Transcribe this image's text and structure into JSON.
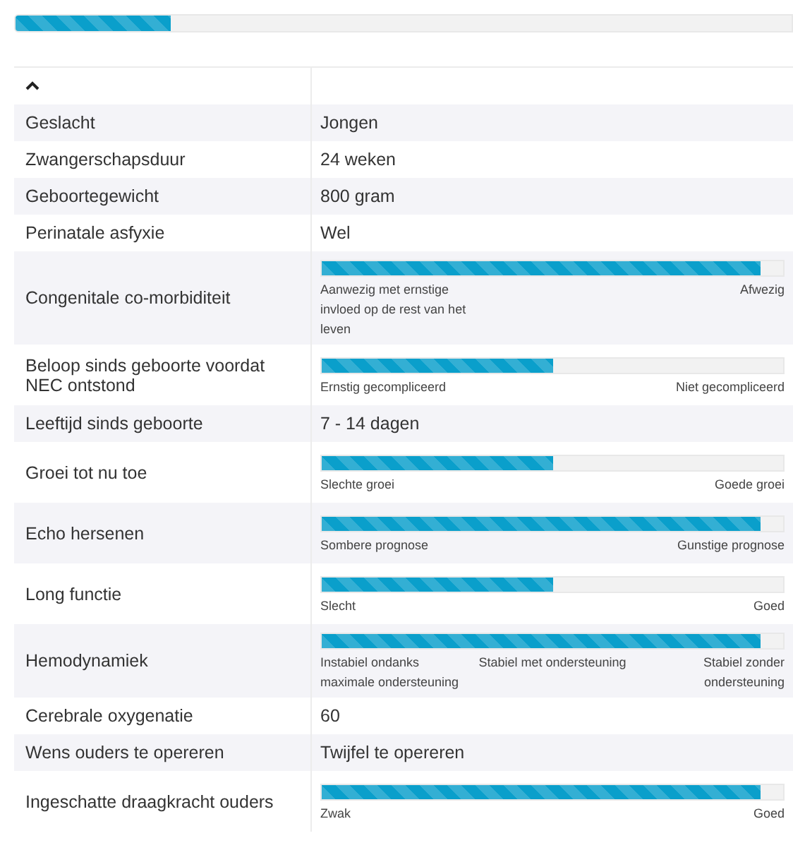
{
  "progress": {
    "level": 0.2
  },
  "table": {
    "collapsed": false,
    "rows": [
      {
        "label": "Geslacht",
        "kind": "text",
        "value": "Jongen"
      },
      {
        "label": "Zwangerschapsduur",
        "kind": "text",
        "value": "24 weken"
      },
      {
        "label": "Geboortegewicht",
        "kind": "text",
        "value": "800 gram"
      },
      {
        "label": "Perinatale asfyxie",
        "kind": "text",
        "value": "Wel"
      },
      {
        "label": "Congenitale co-morbiditeit",
        "kind": "scale",
        "level": 0.95,
        "scale_labels": [
          "Aanwezig met ernstige invloed op de rest van het leven",
          "Afwezig"
        ]
      },
      {
        "label": "Beloop sinds geboorte voordat NEC ontstond",
        "kind": "scale",
        "level": 0.5,
        "scale_labels": [
          "Ernstig gecompliceerd",
          "Niet gecompliceerd"
        ]
      },
      {
        "label": "Leeftijd sinds geboorte",
        "kind": "text",
        "value": "7 - 14 dagen"
      },
      {
        "label": "Groei tot nu toe",
        "kind": "scale",
        "level": 0.5,
        "scale_labels": [
          "Slechte groei",
          "Goede groei"
        ]
      },
      {
        "label": "Echo hersenen",
        "kind": "scale",
        "level": 0.95,
        "scale_labels": [
          "Sombere prognose",
          "Gunstige prognose"
        ]
      },
      {
        "label": "Long functie",
        "kind": "scale",
        "level": 0.5,
        "scale_labels": [
          "Slecht",
          "Goed"
        ]
      },
      {
        "label": "Hemodynamiek",
        "kind": "scale",
        "level": 0.95,
        "scale_labels": [
          "Instabiel ondanks maximale ondersteuning",
          "Stabiel met ondersteuning",
          "Stabiel zonder ondersteuning"
        ]
      },
      {
        "label": "Cerebrale oxygenatie",
        "kind": "text",
        "value": "60"
      },
      {
        "label": "Wens ouders te opereren",
        "kind": "text",
        "value": "Twijfel te opereren"
      },
      {
        "label": "Ingeschatte draagkracht ouders",
        "kind": "scale",
        "level": 0.95,
        "scale_labels": [
          "Zwak",
          "Goed"
        ]
      }
    ]
  }
}
